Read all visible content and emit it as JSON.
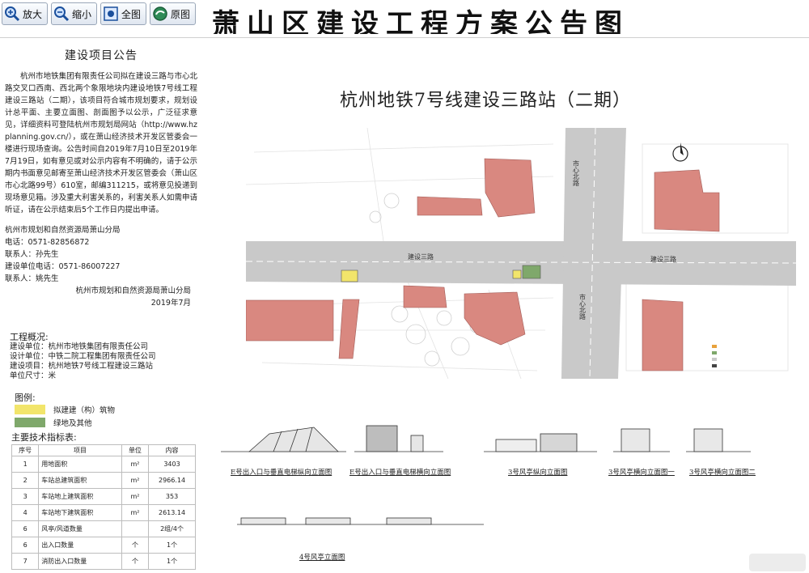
{
  "toolbar": {
    "zoom_in": "放大",
    "zoom_out": "缩小",
    "full_view": "全图",
    "original": "原图"
  },
  "page_title": "萧山区建设工程方案公告图",
  "notice": {
    "heading": "建设项目公告",
    "body": "杭州市地铁集团有限责任公司拟在建设三路与市心北路交叉口西南、西北两个象限地块内建设地铁7号线工程建设三路站（二期），该项目符合城市规划要求，规划设计总平面、主要立面图、剖面图予以公示，广泛征求意见，详细资料可登陆杭州市规划局网站（http://www.hzplanning.gov.cn/），或在萧山经济技术开发区管委会一楼进行现场查询。公告时间自2019年7月10日至2019年7月19日，如有意见或对公示内容有不明确的，请于公示期内书面意见邮寄至萧山经济技术开发区管委会（萧山区市心北路99号）610室，邮编311215，或将意见投递到现场意见箱。涉及重大利害关系的，利害关系人如需申请听证，请在公示结束后5个工作日内提出申请。",
    "contacts": [
      "杭州市规划和自然资源局萧山分局",
      "电话：0571-82856872",
      "联系人：孙先生",
      "建设单位电话：0571-86007227",
      "联系人：姚先生"
    ],
    "signature": "杭州市规划和自然资源局萧山分局",
    "date": "2019年7月"
  },
  "overview": {
    "title": "工程概况:",
    "lines": [
      "建设单位：杭州市地铁集团有限责任公司",
      "设计单位：中铁二院工程集团有限责任公司",
      "建设项目：杭州地铁7号线工程建设三路站",
      "单位尺寸：米"
    ]
  },
  "legend": {
    "title": "图例:",
    "items": [
      {
        "label": "拟建建（构）筑物",
        "color": "#f2e56b"
      },
      {
        "label": "绿地及其他",
        "color": "#7fa86b"
      }
    ]
  },
  "tech": {
    "title": "主要技术指标表:",
    "headers": [
      "序号",
      "项目",
      "单位",
      "内容"
    ],
    "rows": [
      [
        "1",
        "用地面积",
        "m²",
        "3403"
      ],
      [
        "2",
        "车站总建筑面积",
        "m²",
        "2966.14"
      ],
      [
        "3",
        "车站地上建筑面积",
        "m²",
        "353"
      ],
      [
        "4",
        "车站地下建筑面积",
        "m²",
        "2613.14"
      ],
      [
        "6",
        "风亭/风道数量",
        "",
        "2组/4个"
      ],
      [
        "6",
        "出入口数量",
        "个",
        "1个"
      ],
      [
        "7",
        "消防出入口数量",
        "个",
        "1个"
      ]
    ]
  },
  "map": {
    "title": "杭州地铁7号线建设三路站（二期）",
    "road_jianshe": "建设三路",
    "road_shixin_north": "市心北路",
    "road_shixin": "市心北路"
  },
  "elevations": [
    "E号出入口与垂直电梯纵向立面图",
    "E号出入口与垂直电梯横向立面图",
    "3号风亭纵向立面图",
    "3号风亭横向立面图一",
    "3号风亭横向立面图二",
    "4号风亭立面图"
  ],
  "colors": {
    "building": "#d98880",
    "road": "#c9c9c9",
    "proposed": "#f2e56b",
    "green": "#7fa86b"
  }
}
